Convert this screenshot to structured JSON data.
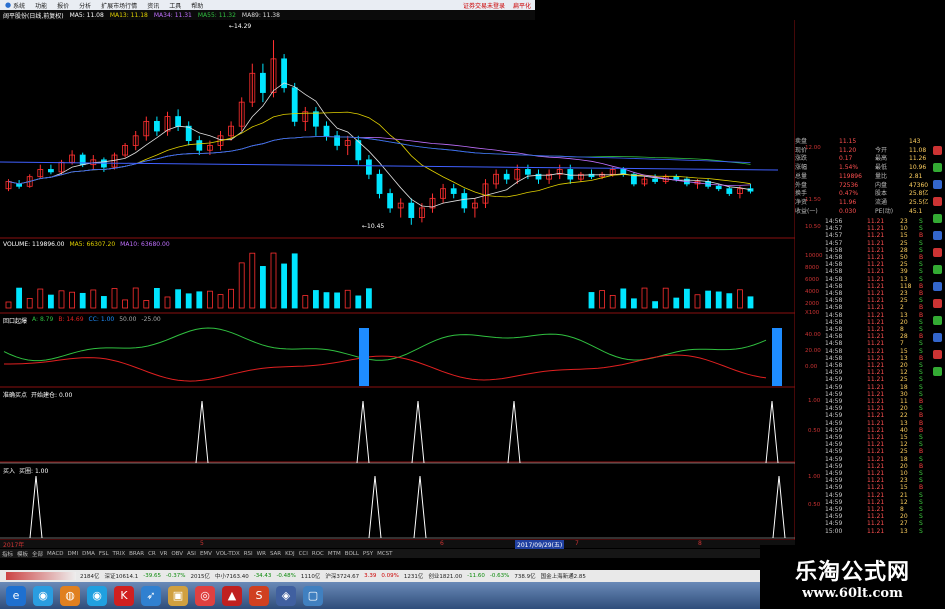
{
  "menu": {
    "items": [
      "系统",
      "功能",
      "报价",
      "分析",
      "扩展市场行情",
      "资讯",
      "工具",
      "帮助"
    ],
    "links": [
      "证券交易未登录",
      "扁平化"
    ]
  },
  "stock_header": {
    "title": "阔平股份(日线,前复权)",
    "ma5": "MA5: 11.08",
    "ma13": "MA13: 11.18",
    "ma34": "MA34: 11.31",
    "ma55": "MA55: 11.32",
    "ma89": "MA89: 11.38"
  },
  "price_chart": {
    "high_label": "14.29",
    "low_label": "10.45",
    "axis": [
      "12.00",
      "11.50",
      "10.50"
    ],
    "candles": [
      {
        "o": 11.2,
        "c": 11.35,
        "h": 11.4,
        "l": 11.15
      },
      {
        "o": 11.3,
        "c": 11.25,
        "h": 11.38,
        "l": 11.2
      },
      {
        "o": 11.25,
        "c": 11.45,
        "h": 11.5,
        "l": 11.22
      },
      {
        "o": 11.45,
        "c": 11.6,
        "h": 11.7,
        "l": 11.4
      },
      {
        "o": 11.6,
        "c": 11.55,
        "h": 11.7,
        "l": 11.5
      },
      {
        "o": 11.55,
        "c": 11.75,
        "h": 11.8,
        "l": 11.5
      },
      {
        "o": 11.75,
        "c": 11.9,
        "h": 12.0,
        "l": 11.7
      },
      {
        "o": 11.9,
        "c": 11.7,
        "h": 11.95,
        "l": 11.65
      },
      {
        "o": 11.7,
        "c": 11.8,
        "h": 11.9,
        "l": 11.6
      },
      {
        "o": 11.8,
        "c": 11.65,
        "h": 11.85,
        "l": 11.55
      },
      {
        "o": 11.65,
        "c": 11.9,
        "h": 11.95,
        "l": 11.6
      },
      {
        "o": 11.9,
        "c": 12.1,
        "h": 12.15,
        "l": 11.85
      },
      {
        "o": 12.1,
        "c": 12.3,
        "h": 12.4,
        "l": 12.0
      },
      {
        "o": 12.3,
        "c": 12.6,
        "h": 12.7,
        "l": 12.2
      },
      {
        "o": 12.6,
        "c": 12.4,
        "h": 12.7,
        "l": 12.3
      },
      {
        "o": 12.4,
        "c": 12.7,
        "h": 12.8,
        "l": 12.3
      },
      {
        "o": 12.7,
        "c": 12.5,
        "h": 12.85,
        "l": 12.4
      },
      {
        "o": 12.5,
        "c": 12.2,
        "h": 12.6,
        "l": 12.1
      },
      {
        "o": 12.2,
        "c": 12.0,
        "h": 12.3,
        "l": 11.9
      },
      {
        "o": 12.0,
        "c": 12.1,
        "h": 12.2,
        "l": 11.9
      },
      {
        "o": 12.1,
        "c": 12.3,
        "h": 12.4,
        "l": 12.0
      },
      {
        "o": 12.3,
        "c": 12.5,
        "h": 12.6,
        "l": 12.2
      },
      {
        "o": 12.5,
        "c": 13.0,
        "h": 13.1,
        "l": 12.4
      },
      {
        "o": 13.0,
        "c": 13.6,
        "h": 13.8,
        "l": 12.9
      },
      {
        "o": 13.6,
        "c": 13.2,
        "h": 13.8,
        "l": 13.0
      },
      {
        "o": 13.2,
        "c": 13.9,
        "h": 14.29,
        "l": 13.1
      },
      {
        "o": 13.9,
        "c": 13.3,
        "h": 14.0,
        "l": 13.2
      },
      {
        "o": 13.3,
        "c": 12.6,
        "h": 13.4,
        "l": 12.5
      },
      {
        "o": 12.6,
        "c": 12.8,
        "h": 12.9,
        "l": 12.4
      },
      {
        "o": 12.8,
        "c": 12.5,
        "h": 12.9,
        "l": 12.3
      },
      {
        "o": 12.5,
        "c": 12.3,
        "h": 12.6,
        "l": 12.2
      },
      {
        "o": 12.3,
        "c": 12.1,
        "h": 12.4,
        "l": 12.0
      },
      {
        "o": 12.1,
        "c": 12.2,
        "h": 12.3,
        "l": 11.9
      },
      {
        "o": 12.2,
        "c": 11.8,
        "h": 12.3,
        "l": 11.7
      },
      {
        "o": 11.8,
        "c": 11.5,
        "h": 11.9,
        "l": 11.4
      },
      {
        "o": 11.5,
        "c": 11.1,
        "h": 11.6,
        "l": 11.0
      },
      {
        "o": 11.1,
        "c": 10.8,
        "h": 11.2,
        "l": 10.7
      },
      {
        "o": 10.8,
        "c": 10.9,
        "h": 11.0,
        "l": 10.6
      },
      {
        "o": 10.9,
        "c": 10.6,
        "h": 11.0,
        "l": 10.45
      },
      {
        "o": 10.6,
        "c": 10.8,
        "h": 10.9,
        "l": 10.5
      },
      {
        "o": 10.8,
        "c": 11.0,
        "h": 11.1,
        "l": 10.7
      },
      {
        "o": 11.0,
        "c": 11.2,
        "h": 11.3,
        "l": 10.9
      },
      {
        "o": 11.2,
        "c": 11.1,
        "h": 11.3,
        "l": 11.0
      },
      {
        "o": 11.1,
        "c": 10.8,
        "h": 11.2,
        "l": 10.7
      },
      {
        "o": 10.8,
        "c": 10.9,
        "h": 11.0,
        "l": 10.6
      },
      {
        "o": 10.9,
        "c": 11.3,
        "h": 11.4,
        "l": 10.8
      },
      {
        "o": 11.3,
        "c": 11.5,
        "h": 11.6,
        "l": 11.2
      },
      {
        "o": 11.5,
        "c": 11.4,
        "h": 11.6,
        "l": 11.3
      },
      {
        "o": 11.4,
        "c": 11.6,
        "h": 11.7,
        "l": 11.3
      },
      {
        "o": 11.6,
        "c": 11.5,
        "h": 11.7,
        "l": 11.4
      },
      {
        "o": 11.5,
        "c": 11.4,
        "h": 11.6,
        "l": 11.3
      },
      {
        "o": 11.4,
        "c": 11.5,
        "h": 11.6,
        "l": 11.3
      },
      {
        "o": 11.5,
        "c": 11.6,
        "h": 11.7,
        "l": 11.4
      },
      {
        "o": 11.6,
        "c": 11.4,
        "h": 11.7,
        "l": 11.3
      },
      {
        "o": 11.4,
        "c": 11.5,
        "h": 11.55,
        "l": 11.35
      },
      {
        "o": 11.5,
        "c": 11.45,
        "h": 11.6,
        "l": 11.4
      },
      {
        "o": 11.45,
        "c": 11.5,
        "h": 11.55,
        "l": 11.4
      },
      {
        "o": 11.5,
        "c": 11.6,
        "h": 11.65,
        "l": 11.45
      },
      {
        "o": 11.6,
        "c": 11.5,
        "h": 11.65,
        "l": 11.45
      },
      {
        "o": 11.5,
        "c": 11.3,
        "h": 11.55,
        "l": 11.25
      },
      {
        "o": 11.3,
        "c": 11.4,
        "h": 11.45,
        "l": 11.25
      },
      {
        "o": 11.4,
        "c": 11.35,
        "h": 11.5,
        "l": 11.3
      },
      {
        "o": 11.35,
        "c": 11.45,
        "h": 11.5,
        "l": 11.3
      },
      {
        "o": 11.45,
        "c": 11.4,
        "h": 11.5,
        "l": 11.35
      },
      {
        "o": 11.4,
        "c": 11.3,
        "h": 11.45,
        "l": 11.25
      },
      {
        "o": 11.3,
        "c": 11.35,
        "h": 11.4,
        "l": 11.2
      },
      {
        "o": 11.35,
        "c": 11.25,
        "h": 11.4,
        "l": 11.2
      },
      {
        "o": 11.25,
        "c": 11.2,
        "h": 11.3,
        "l": 11.15
      },
      {
        "o": 11.2,
        "c": 11.1,
        "h": 11.25,
        "l": 11.05
      },
      {
        "o": 11.1,
        "c": 11.2,
        "h": 11.25,
        "l": 11.0
      },
      {
        "o": 11.2,
        "c": 11.15,
        "h": 11.3,
        "l": 11.1
      }
    ]
  },
  "volume_header": {
    "title": "VOLUME: 119896.00",
    "ma5": "MA5: 66307.20",
    "ma10": "MA10: 63680.00"
  },
  "volume_axis": [
    "10000",
    "8000",
    "6000",
    "4000",
    "2000",
    "X100"
  ],
  "osc_header": {
    "title": "回口起爆",
    "values": [
      "A: 8.79",
      "B: 14.69",
      "CC: 1.00",
      "50.00",
      "-25.00"
    ]
  },
  "osc_axis": [
    "40.00",
    "20.00",
    "0.00"
  ],
  "signal1_header": {
    "title": "准确买点",
    "value": "开始建仓: 0.00"
  },
  "signal1_axis": [
    "1.00",
    "0.50"
  ],
  "signal2_header": {
    "title": "买入",
    "value": "买圈: 1.00"
  },
  "signal2_axis": [
    "1.00",
    "0.50"
  ],
  "time_labels": [
    "2017年",
    "5",
    "6",
    "2017/09/29(五)",
    "7",
    "8"
  ],
  "indicator_tabs": [
    "指标",
    "模板",
    "全部",
    "MACD",
    "DMI",
    "DMA",
    "FSL",
    "TRIX",
    "BRAR",
    "CR",
    "VR",
    "OBV",
    "ASI",
    "EMV",
    "VOL-TDX",
    "RSI",
    "WR",
    "SAR",
    "KDJ",
    "CCI",
    "ROC",
    "MTM",
    "BOLL",
    "PSY",
    "MCST"
  ],
  "quote_panel": {
    "rows": [
      {
        "l1": "卖盘",
        "v1": "11.15",
        "l2": "",
        "v2": "143"
      },
      {
        "l1": "现价",
        "v1": "11.20",
        "l2": "今开",
        "v2": "11.08"
      },
      {
        "l1": "涨跌",
        "v1": "0.17",
        "l2": "最高",
        "v2": "11.26"
      },
      {
        "l1": "涨幅",
        "v1": "1.54%",
        "l2": "最低",
        "v2": "10.96"
      },
      {
        "l1": "总量",
        "v1": "119896",
        "l2": "量比",
        "v2": "2.81"
      },
      {
        "l1": "外盘",
        "v1": "72536",
        "l2": "内盘",
        "v2": "47360"
      },
      {
        "l1": "换手",
        "v1": "0.47%",
        "l2": "股本",
        "v2": "25.8亿"
      },
      {
        "l1": "净资",
        "v1": "11.96",
        "l2": "流通",
        "v2": "25.5亿"
      },
      {
        "l1": "收益(一)",
        "v1": "0.030",
        "l2": "PE(动)",
        "v2": "45.1"
      }
    ],
    "ticks": [
      {
        "t": "14:56",
        "p": "11.21",
        "v": "23",
        "d": "S"
      },
      {
        "t": "14:57",
        "p": "11.21",
        "v": "10",
        "d": "S"
      },
      {
        "t": "14:57",
        "p": "11.21",
        "v": "15",
        "d": "B"
      },
      {
        "t": "14:57",
        "p": "11.21",
        "v": "25",
        "d": "S"
      },
      {
        "t": "14:58",
        "p": "11.21",
        "v": "28",
        "d": "S"
      },
      {
        "t": "14:58",
        "p": "11.21",
        "v": "50",
        "d": "B"
      },
      {
        "t": "14:58",
        "p": "11.21",
        "v": "25",
        "d": "S"
      },
      {
        "t": "14:58",
        "p": "11.21",
        "v": "39",
        "d": "S"
      },
      {
        "t": "14:58",
        "p": "11.21",
        "v": "13",
        "d": "S"
      },
      {
        "t": "14:58",
        "p": "11.21",
        "v": "118",
        "d": "B"
      },
      {
        "t": "14:58",
        "p": "11.21",
        "v": "23",
        "d": "B"
      },
      {
        "t": "14:58",
        "p": "11.21",
        "v": "25",
        "d": "S"
      },
      {
        "t": "14:58",
        "p": "11.21",
        "v": "2",
        "d": "B"
      },
      {
        "t": "14:58",
        "p": "11.21",
        "v": "13",
        "d": "B"
      },
      {
        "t": "14:58",
        "p": "11.21",
        "v": "20",
        "d": "S"
      },
      {
        "t": "14:58",
        "p": "11.21",
        "v": "8",
        "d": "S"
      },
      {
        "t": "14:58",
        "p": "11.21",
        "v": "28",
        "d": "B"
      },
      {
        "t": "14:58",
        "p": "11.21",
        "v": "7",
        "d": "S"
      },
      {
        "t": "14:58",
        "p": "11.21",
        "v": "15",
        "d": "S"
      },
      {
        "t": "14:58",
        "p": "11.21",
        "v": "13",
        "d": "B"
      },
      {
        "t": "14:58",
        "p": "11.21",
        "v": "20",
        "d": "S"
      },
      {
        "t": "14:59",
        "p": "11.21",
        "v": "12",
        "d": "S"
      },
      {
        "t": "14:59",
        "p": "11.21",
        "v": "25",
        "d": "S"
      },
      {
        "t": "14:59",
        "p": "11.21",
        "v": "18",
        "d": "S"
      },
      {
        "t": "14:59",
        "p": "11.21",
        "v": "30",
        "d": "S"
      },
      {
        "t": "14:59",
        "p": "11.21",
        "v": "11",
        "d": "B"
      },
      {
        "t": "14:59",
        "p": "11.21",
        "v": "20",
        "d": "S"
      },
      {
        "t": "14:59",
        "p": "11.21",
        "v": "22",
        "d": "B"
      },
      {
        "t": "14:59",
        "p": "11.21",
        "v": "13",
        "d": "B"
      },
      {
        "t": "14:59",
        "p": "11.21",
        "v": "40",
        "d": "B"
      },
      {
        "t": "14:59",
        "p": "11.21",
        "v": "15",
        "d": "S"
      },
      {
        "t": "14:59",
        "p": "11.21",
        "v": "12",
        "d": "S"
      },
      {
        "t": "14:59",
        "p": "11.21",
        "v": "25",
        "d": "B"
      },
      {
        "t": "14:59",
        "p": "11.21",
        "v": "18",
        "d": "S"
      },
      {
        "t": "14:59",
        "p": "11.21",
        "v": "20",
        "d": "B"
      },
      {
        "t": "14:59",
        "p": "11.21",
        "v": "10",
        "d": "S"
      },
      {
        "t": "14:59",
        "p": "11.21",
        "v": "23",
        "d": "S"
      },
      {
        "t": "14:59",
        "p": "11.21",
        "v": "15",
        "d": "B"
      },
      {
        "t": "14:59",
        "p": "11.21",
        "v": "21",
        "d": "S"
      },
      {
        "t": "14:59",
        "p": "11.21",
        "v": "12",
        "d": "S"
      },
      {
        "t": "14:59",
        "p": "11.21",
        "v": "8",
        "d": "S"
      },
      {
        "t": "14:59",
        "p": "11.21",
        "v": "20",
        "d": "S"
      },
      {
        "t": "14:59",
        "p": "11.21",
        "v": "27",
        "d": "S"
      },
      {
        "t": "15:00",
        "p": "11.21",
        "v": "13",
        "d": "S"
      }
    ]
  },
  "status_bar": {
    "items": [
      "2184亿",
      "深证10614.1",
      "-39.65",
      "-0.37%",
      "2015亿",
      "中小7163.40",
      "-34.43",
      "-0.48%",
      "1110亿",
      "沪深3724.67",
      "3.39",
      "0.09%",
      "1231亿",
      "创业1821.00",
      "-11.60",
      "-0.63%",
      "738.9亿",
      "国金上海新通2.85"
    ]
  },
  "taskbar_icons": [
    "ie-icon",
    "ball-icon",
    "orange-icon",
    "ball2-icon",
    "k-icon",
    "wing-icon",
    "folder-icon",
    "chrome-icon",
    "pdf-icon",
    "s-icon",
    "db-icon",
    "app-icon"
  ],
  "watermark": {
    "title": "乐淘公式网",
    "url": "www.60lt.com"
  },
  "colors": {
    "up": "#ff3030",
    "down": "#00e5ff",
    "ma_white": "#e0e0e0",
    "ma_yellow": "#e0d000",
    "ma_purple": "#c070ff",
    "ma_blue": "#4060ff",
    "osc_green": "#30c040",
    "osc_red": "#e02020",
    "signal_white": "#ffffff",
    "grid_red": "#8a1010"
  }
}
